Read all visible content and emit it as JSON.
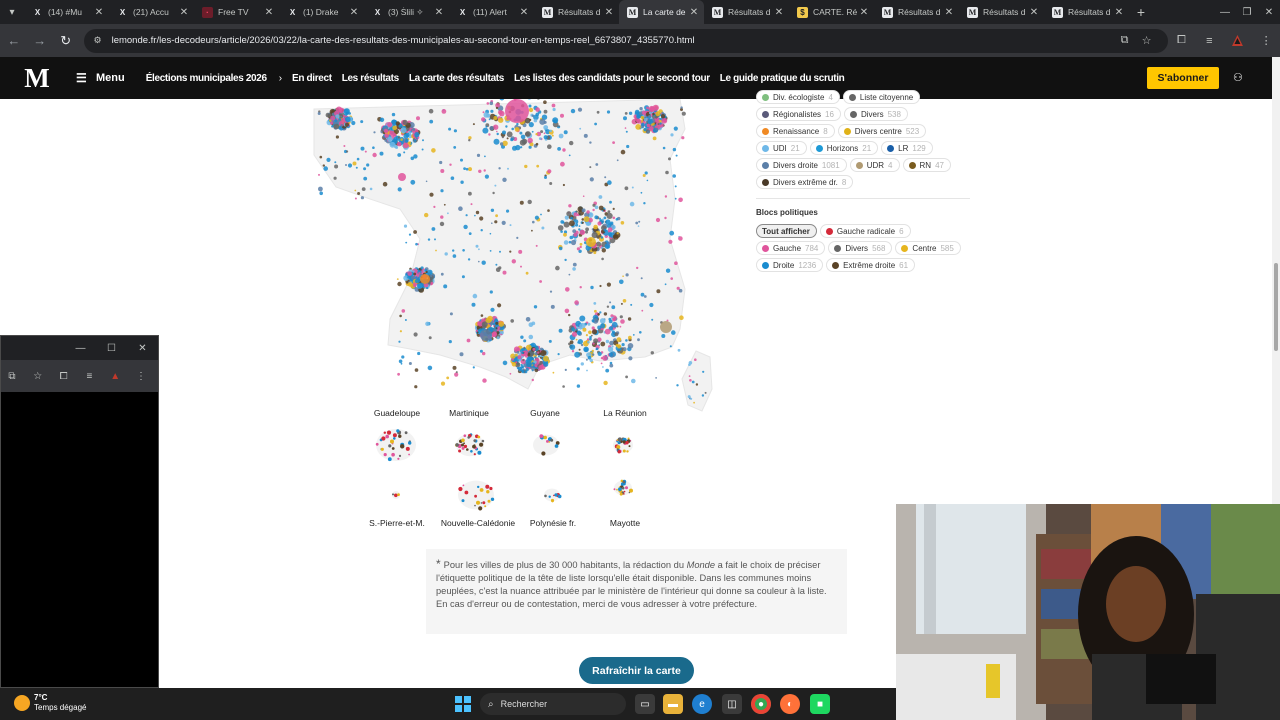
{
  "browser": {
    "tabs": [
      {
        "title": "(14) #Mu",
        "favicon": "x-icon",
        "active": false
      },
      {
        "title": "(21) Accu",
        "favicon": "x-icon",
        "active": false
      },
      {
        "title": "Free TV",
        "favicon": "free-tv-icon",
        "active": false
      },
      {
        "title": "(1) Drake",
        "favicon": "x-icon",
        "active": false
      },
      {
        "title": "(3) Ṡlili ✧",
        "favicon": "x-icon",
        "active": false
      },
      {
        "title": "(11) Alert",
        "favicon": "x-icon",
        "active": false
      },
      {
        "title": "Résultats d",
        "favicon": "le-monde-icon",
        "active": false
      },
      {
        "title": "La carte de",
        "favicon": "le-monde-icon",
        "active": true
      },
      {
        "title": "Résultats d",
        "favicon": "le-monde-icon",
        "active": false
      },
      {
        "title": "CARTE. Ré",
        "favicon": "carte-icon",
        "active": false
      },
      {
        "title": "Résultats d",
        "favicon": "le-monde-icon",
        "active": false
      },
      {
        "title": "Résultats d",
        "favicon": "le-monde-icon",
        "active": false
      },
      {
        "title": "Résultats d",
        "favicon": "le-monde-icon",
        "active": false
      }
    ],
    "url": "lemonde.fr/les-decodeurs/article/2026/03/22/la-carte-des-resultats-des-municipales-au-second-tour-en-temps-reel_6673807_4355770.html"
  },
  "site": {
    "logo": "M",
    "menu_label": "Menu",
    "nav": [
      "Élections municipales 2026",
      "En direct",
      "Les résultats",
      "La carte des résultats",
      "Les listes des candidats pour le second tour",
      "Le guide pratique du scrutin"
    ],
    "subscribe_label": "S'abonner"
  },
  "legend": {
    "partial_row": [
      {
        "label": "Div. écologiste",
        "count": "4",
        "color": "#7fbf7f"
      },
      {
        "label": "Liste citoyenne",
        "count": "",
        "color": "#666666"
      }
    ],
    "parties": [
      [
        {
          "label": "Régionalistes",
          "count": "16",
          "color": "#5a5a7a"
        },
        {
          "label": "Divers",
          "count": "538",
          "color": "#666666"
        }
      ],
      [
        {
          "label": "Renaissance",
          "count": "8",
          "color": "#f08a24"
        },
        {
          "label": "Divers centre",
          "count": "523",
          "color": "#e0b218"
        }
      ],
      [
        {
          "label": "UDI",
          "count": "21",
          "color": "#6fb8e8"
        },
        {
          "label": "Horizons",
          "count": "21",
          "color": "#1e9ad6"
        },
        {
          "label": "LR",
          "count": "129",
          "color": "#1a5fa8"
        }
      ],
      [
        {
          "label": "Divers droite",
          "count": "1081",
          "color": "#5b7fa8"
        },
        {
          "label": "UDR",
          "count": "4",
          "color": "#b09a72"
        },
        {
          "label": "RN",
          "count": "47",
          "color": "#7a5c1e"
        }
      ],
      [
        {
          "label": "Divers extrême dr.",
          "count": "8",
          "color": "#4a3a28"
        }
      ]
    ],
    "blocs_heading": "Blocs politiques",
    "blocs": [
      [
        {
          "label": "Tout afficher",
          "count": "",
          "color": "",
          "selected": true
        },
        {
          "label": "Gauche radicale",
          "count": "6",
          "color": "#d42a3a"
        }
      ],
      [
        {
          "label": "Gauche",
          "count": "784",
          "color": "#e0559c"
        },
        {
          "label": "Divers",
          "count": "568",
          "color": "#666666"
        },
        {
          "label": "Centre",
          "count": "585",
          "color": "#e6b51e"
        }
      ],
      [
        {
          "label": "Droite",
          "count": "1236",
          "color": "#1a8ccf"
        },
        {
          "label": "Extrême droite",
          "count": "61",
          "color": "#5a4326"
        }
      ]
    ]
  },
  "overseas": {
    "labels": [
      "Guadeloupe",
      "Martinique",
      "Guyane",
      "La Réunion",
      "S.-Pierre-et-M.",
      "Nouvelle-Calédonie",
      "Polynésie fr.",
      "Mayotte"
    ]
  },
  "note": {
    "star": "*",
    "before": "Pour les villes de plus de 30 000 habitants, la rédaction du ",
    "italic": "Monde",
    "after": " a fait le choix de préciser l'étiquette politique de la tête de liste lorsqu'elle était disponible. Dans les communes moins peuplées, c'est la nuance attribuée par le ministère de l'intérieur qui donne sa couleur à la liste. En cas d'erreur ou de contestation, merci de vous adresser à votre préfecture."
  },
  "refresh_label": "Rafraîchir la carte",
  "taskbar": {
    "temperature": "7°C",
    "weather": "Temps dégagé",
    "search_label": "Rechercher"
  },
  "colors": {
    "header_bg": "#111111",
    "subscribe_bg": "#ffc600",
    "refresh_bg": "#1a6a8c",
    "map_land": "#f2f2f2"
  }
}
